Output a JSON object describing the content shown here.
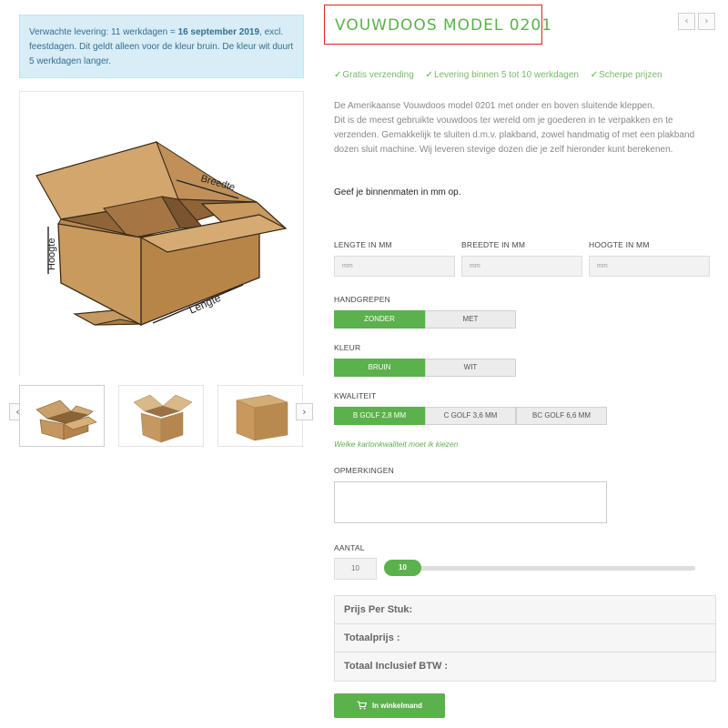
{
  "delivery_notice": {
    "prefix": "Verwachte levering: 11 werkdagen = ",
    "date": "16 september 2019",
    "suffix": ", excl. feestdagen. Dit geldt alleen voor de kleur bruin. De kleur wit duurt 5 werkdagen langer."
  },
  "gallery": {
    "main_image_labels": {
      "width": "Breedte",
      "height": "Hoogte",
      "length": "Lengte"
    },
    "prev_icon": "chevron-left-icon",
    "next_icon": "chevron-right-icon",
    "prev_symbol": "‹",
    "next_symbol": "›"
  },
  "product": {
    "title": "VOUWDOOS MODEL 0201",
    "usps": [
      "Gratis verzending",
      "Levering binnen 5 tot 10 werkdagen",
      "Scherpe prijzen"
    ],
    "check_symbol": "✓",
    "description": "De Amerikaanse Vouwdoos model 0201 met onder en boven sluitende kleppen.\nDit is de meest gebruikte vouwdoos ter wereld om je goederen in te verpakken en te verzenden. Gemakkelijk te sluiten d.m.v. plakband, zowel handmatig of met een plakband dozen sluit machine. Wij leveren stevige dozen die je zelf hieronder kunt berekenen.",
    "instruction": "Geef je binnenmaten in mm op."
  },
  "dimensions": {
    "length_label": "LENGTE IN MM",
    "width_label": "BREEDTE IN MM",
    "height_label": "HOOGTE IN MM",
    "placeholder": "mm"
  },
  "handles": {
    "label": "HANDGREPEN",
    "options": [
      "ZONDER",
      "MET"
    ],
    "selected": "ZONDER"
  },
  "color": {
    "label": "KLEUR",
    "options": [
      "BRUIN",
      "WIT"
    ],
    "selected": "BRUIN"
  },
  "quality": {
    "label": "KWALITEIT",
    "options": [
      "B GOLF 2,8 MM",
      "C GOLF 3,6 MM",
      "BC GOLF 6,6 MM"
    ],
    "selected": "B GOLF 2,8 MM",
    "help_link": "Welke kartonkwaliteit moet ik kiezen"
  },
  "remarks": {
    "label": "OPMERKINGEN",
    "value": ""
  },
  "quantity": {
    "label": "AANTAL",
    "value": "10",
    "slider_value": "10"
  },
  "pricing": {
    "per_piece_label": "Prijs Per Stuk:",
    "total_label": "Totaalprijs :",
    "total_incl_vat_label": "Totaal Inclusief BTW :"
  },
  "cart_button": {
    "label": "In winkelmand",
    "icon": "cart-icon"
  },
  "colors": {
    "accent": "#5bb14b",
    "notice_bg": "#d9edf7",
    "notice_text": "#31708f",
    "title_border": "#e02020"
  }
}
